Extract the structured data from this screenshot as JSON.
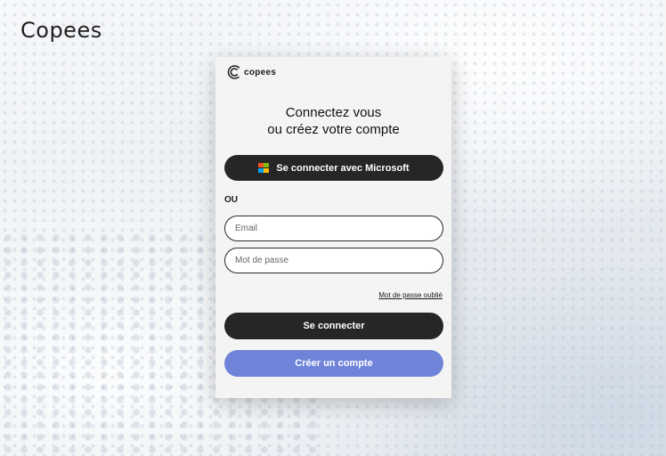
{
  "page": {
    "brand": "Copees"
  },
  "card": {
    "logo_text": "copees",
    "logo_icon": "copees-logo-icon",
    "heading_line1": "Connectez vous",
    "heading_line2": "ou créez votre compte",
    "microsoft_button_label": "Se connecter avec Microsoft",
    "microsoft_icon": "microsoft-logo-icon",
    "or_label": "OU",
    "email_placeholder": "Email",
    "password_placeholder": "Mot de passe",
    "forgot_password_link": "Mot de passe oublié",
    "login_button_label": "Se connecter",
    "create_account_button_label": "Créer un compte"
  },
  "colors": {
    "dark_button": "#262626",
    "create_button": "#6f84d8",
    "card_background": "#f4f4f4",
    "microsoft": [
      "#f25022",
      "#7fba00",
      "#00a4ef",
      "#ffb900"
    ]
  }
}
